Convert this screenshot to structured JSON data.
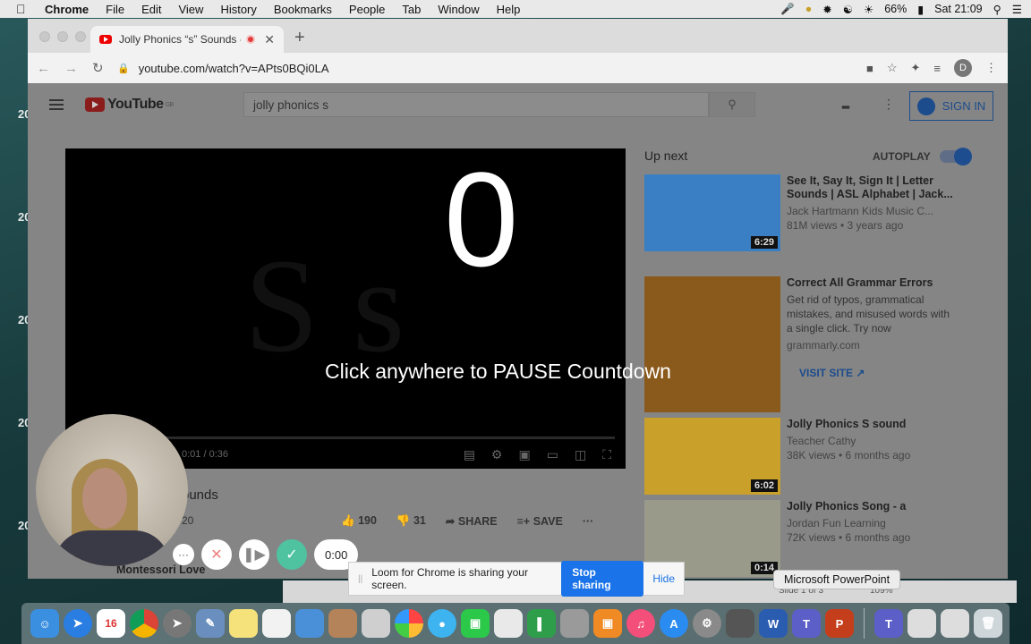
{
  "menubar": {
    "app": "Chrome",
    "items": [
      "File",
      "Edit",
      "View",
      "History",
      "Bookmarks",
      "People",
      "Tab",
      "Window",
      "Help"
    ],
    "battery": "66%",
    "clock": "Sat 21:09"
  },
  "desktop": {
    "side_labels": [
      "20",
      "20",
      "20",
      "20",
      "20",
      "20"
    ]
  },
  "browser": {
    "tab_title": "Jolly Phonics “s” Sounds -",
    "url": "youtube.com/watch?v=APts0BQi0LA",
    "profile_initial": "D"
  },
  "youtube": {
    "logo": "YouTube",
    "logo_region": "GB",
    "search_value": "jolly phonics s",
    "sign_in": "SIGN IN",
    "player_time": "0:01 / 0:36",
    "video_title_partial": "ounds",
    "video_date_partial": "20",
    "likes": "190",
    "dislikes": "31",
    "share": "SHARE",
    "save": "SAVE",
    "channel": "Montessori Love",
    "up_next": "Up next",
    "autoplay": "AUTOPLAY",
    "recommendations": [
      {
        "title": "See It, Say It, Sign It | Letter Sounds | ASL Alphabet | Jack...",
        "channel": "Jack Hartmann Kids Music C...",
        "stats": "81M views • 3 years ago",
        "duration": "6:29",
        "thumb_color": "#3a7fc4"
      },
      {
        "title": "Correct All Grammar Errors",
        "description": "Get rid of typos, grammatical mistakes, and misused words with a single click. Try now",
        "channel": "grammarly.com",
        "cta": "VISIT SITE",
        "thumb_color": "#8a5a1c"
      },
      {
        "title": "Jolly Phonics S sound",
        "channel": "Teacher Cathy",
        "stats": "38K views • 6 months ago",
        "duration": "6:02",
        "thumb_color": "#c9a02a"
      },
      {
        "title": "Jolly Phonics Song - a",
        "channel": "Jordan Fun Learning",
        "stats": "72K views • 6 months ago",
        "duration": "0:14",
        "thumb_color": "#9a9a8a"
      }
    ]
  },
  "loom": {
    "countdown": "0",
    "message": "Click anywhere to PAUSE Countdown",
    "timer": "0:00",
    "share_message": "Loom for Chrome is sharing your screen.",
    "stop_sharing": "Stop sharing",
    "hide": "Hide"
  },
  "powerpoint": {
    "tooltip": "Microsoft PowerPoint",
    "slide_status": "Slide 1 of 3",
    "zoom": "109%"
  },
  "dock": {
    "calendar_day": "16"
  }
}
